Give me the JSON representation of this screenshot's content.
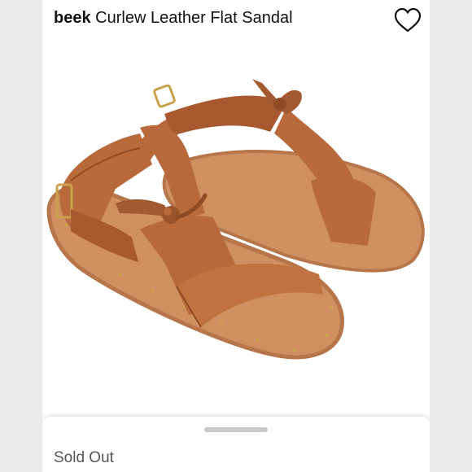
{
  "listing": {
    "brand": "beek",
    "title": "Curlew Leather Flat Sandal"
  },
  "icons": {
    "favorite": "heart-outline-icon"
  },
  "product_image": {
    "subject": "tan leather flat sandals",
    "colors": {
      "leather": "#b96a3c",
      "leather_dark": "#8f4b26",
      "sole": "#d08f60",
      "sole_edge": "#b6764a",
      "rivet": "#c9a24a"
    }
  },
  "sheet": {
    "status": "Sold Out"
  }
}
